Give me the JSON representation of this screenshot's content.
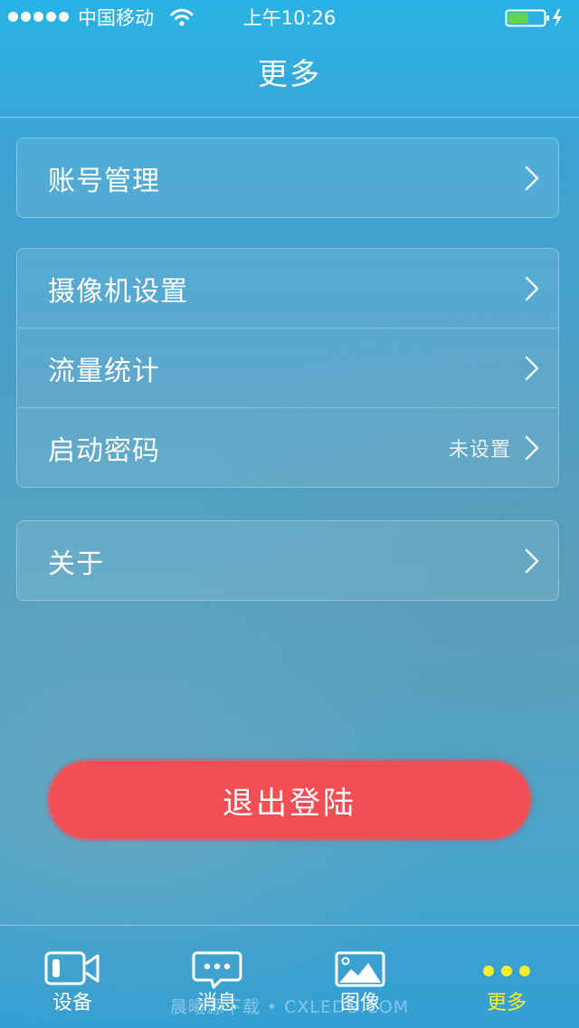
{
  "status_bar": {
    "carrier": "中国移动",
    "time": "上午10:26",
    "battery_color": "#62d64a"
  },
  "nav": {
    "title": "更多"
  },
  "groups": [
    {
      "rows": [
        {
          "label": "账号管理",
          "value": ""
        }
      ]
    },
    {
      "rows": [
        {
          "label": "摄像机设置",
          "value": ""
        },
        {
          "label": "流量统计",
          "value": ""
        },
        {
          "label": "启动密码",
          "value": "未设置"
        }
      ]
    },
    {
      "rows": [
        {
          "label": "关于",
          "value": ""
        }
      ]
    }
  ],
  "logout": {
    "label": "退出登陆",
    "color": "#f24e55"
  },
  "tab_bar": {
    "active_color": "#f8ef2a",
    "tabs": [
      {
        "label": "设备",
        "icon": "video-camera-icon"
      },
      {
        "label": "消息",
        "icon": "chat-bubble-icon"
      },
      {
        "label": "图像",
        "icon": "image-icon"
      },
      {
        "label": "更多",
        "icon": "more-dots-icon",
        "active": true
      }
    ]
  },
  "watermark": "晨曦源下载 • CXLEDU.COM"
}
